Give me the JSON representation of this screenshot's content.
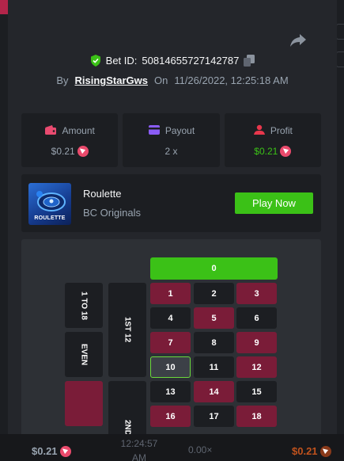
{
  "bet": {
    "label": "Bet ID:",
    "id": "50814655727142787",
    "by_label": "By",
    "username": "RisingStarGws",
    "on_label": "On",
    "datetime": "11/26/2022, 12:25:18 AM"
  },
  "stats": {
    "amount": {
      "label": "Amount",
      "value": "$0.21"
    },
    "payout": {
      "label": "Payout",
      "value": "2 x"
    },
    "profit": {
      "label": "Profit",
      "value": "$0.21"
    }
  },
  "game": {
    "thumb_text": "ROULETTE",
    "name": "Roulette",
    "provider": "BC Originals",
    "play_label": "Play Now"
  },
  "board": {
    "zero": "0",
    "selected": "10",
    "rows": [
      [
        "1",
        "2",
        "3"
      ],
      [
        "4",
        "5",
        "6"
      ],
      [
        "7",
        "8",
        "9"
      ],
      [
        "10",
        "11",
        "12"
      ],
      [
        "13",
        "14",
        "15"
      ],
      [
        "16",
        "17",
        "18"
      ]
    ],
    "reds": [
      "1",
      "3",
      "5",
      "7",
      "9",
      "12",
      "14",
      "16",
      "18"
    ],
    "side_labels": {
      "one_to_18": "1 TO 18",
      "even": "EVEN",
      "first_12": "1ST 12",
      "second_12": "2ND"
    }
  },
  "footer": {
    "left_amount": "$0.21",
    "time": "12:24:57 AM",
    "multiplier": "0.00×",
    "right_amount": "$0.21"
  },
  "colors": {
    "accent_green": "#3bc117",
    "roulette_red": "#7a1c38",
    "coin_pink": "#ea4a6c",
    "amount_icon": "#e94b70",
    "payout_icon": "#8a5cf6",
    "profit_icon": "#e8374c"
  },
  "icons": {
    "share": "share-icon",
    "shield": "shield-check-icon",
    "copy": "copy-icon",
    "amount": "wallet-icon",
    "payout": "payout-icon",
    "profit": "profit-icon",
    "coin": "tron-coin-icon"
  }
}
